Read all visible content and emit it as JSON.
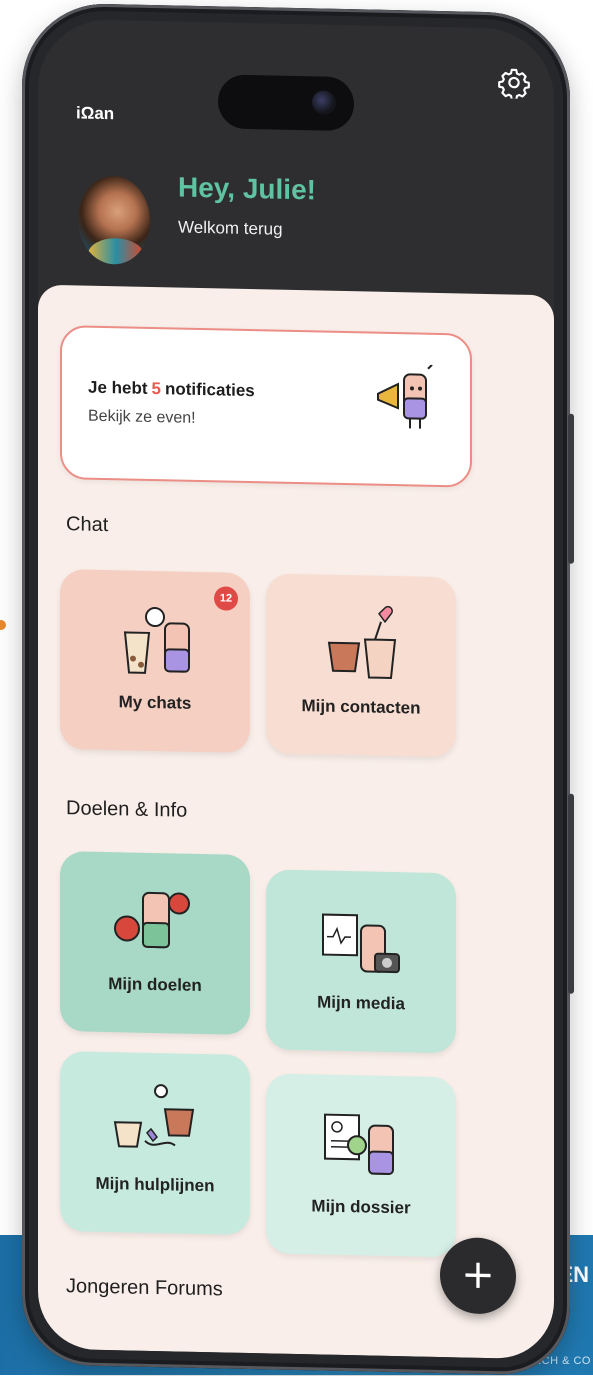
{
  "app": {
    "logo": "iΩan"
  },
  "header": {
    "greeting": "Hey, Julie!",
    "subtitle": "Welkom terug"
  },
  "notification": {
    "prefix": "Je hebt",
    "count": "5",
    "suffix": "notificaties",
    "subtext": "Bekijk ze even!"
  },
  "sections": {
    "chat": "Chat",
    "goals": "Doelen & Info",
    "forums": "Jongeren Forums"
  },
  "tiles": {
    "my_chats": {
      "label": "My chats",
      "badge": "12"
    },
    "contacts": {
      "label": "Mijn contacten"
    },
    "goals": {
      "label": "Mijn doelen"
    },
    "media": {
      "label": "Mijn media"
    },
    "helplines": {
      "label": "Mijn hulplijnen"
    },
    "dossier": {
      "label": "Mijn dossier"
    }
  },
  "fab": {
    "icon": "+"
  },
  "banner": {
    "text": "EN",
    "subtext": "EARCH & CO"
  },
  "colors": {
    "accent_green": "#5fc2a0",
    "accent_red": "#e85b52",
    "chat_tile": "#f6cfc3",
    "goal_tile": "#a8d9c6",
    "background": "#f9eee9"
  }
}
